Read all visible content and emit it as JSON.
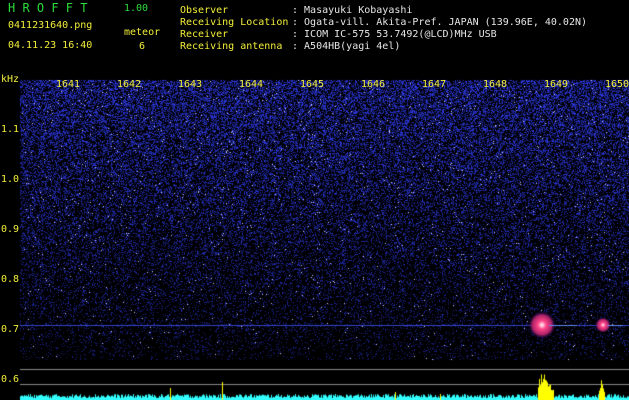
{
  "header": {
    "app_title": "H R O F F T",
    "version": "1.00",
    "filename": "0411231640.png",
    "datetime": "04.11.23 16:40",
    "meteor_label": "meteor",
    "meteor_count": "6",
    "fields": [
      {
        "label": "Observer",
        "value": ": Masayuki Kobayashi"
      },
      {
        "label": "Receiving Location",
        "value": ": Ogata-vill. Akita-Pref. JAPAN (139.96E, 40.02N)"
      },
      {
        "label": "Receiver",
        "value": ": ICOM IC-575 53.7492(@LCD)MHz USB"
      },
      {
        "label": "Receiving antenna",
        "value": ": A504HB(yagi 4el)"
      }
    ]
  },
  "colors": {
    "title": "#2bdc3a",
    "label": "#f2ef3a",
    "text": "#e6e6e6",
    "background": "#000000",
    "noise": "#2233ff",
    "trace": "#33ffff",
    "echo": "#ffff00"
  },
  "chart_data": {
    "type": "heatmap",
    "ylabel": "kHz",
    "y_ticks": [
      "1.1",
      "1.0",
      "0.9",
      "0.8",
      "0.7",
      "0.6"
    ],
    "x_ticks": [
      "1641",
      "1642",
      "1643",
      "1644",
      "1645",
      "1646",
      "1647",
      "1648",
      "1649",
      "1650"
    ],
    "meteor_echoes": [
      {
        "time": "1649",
        "freq_khz": 0.71,
        "strength": "strong"
      },
      {
        "time": "1650",
        "freq_khz": 0.71,
        "strength": "medium"
      }
    ]
  }
}
